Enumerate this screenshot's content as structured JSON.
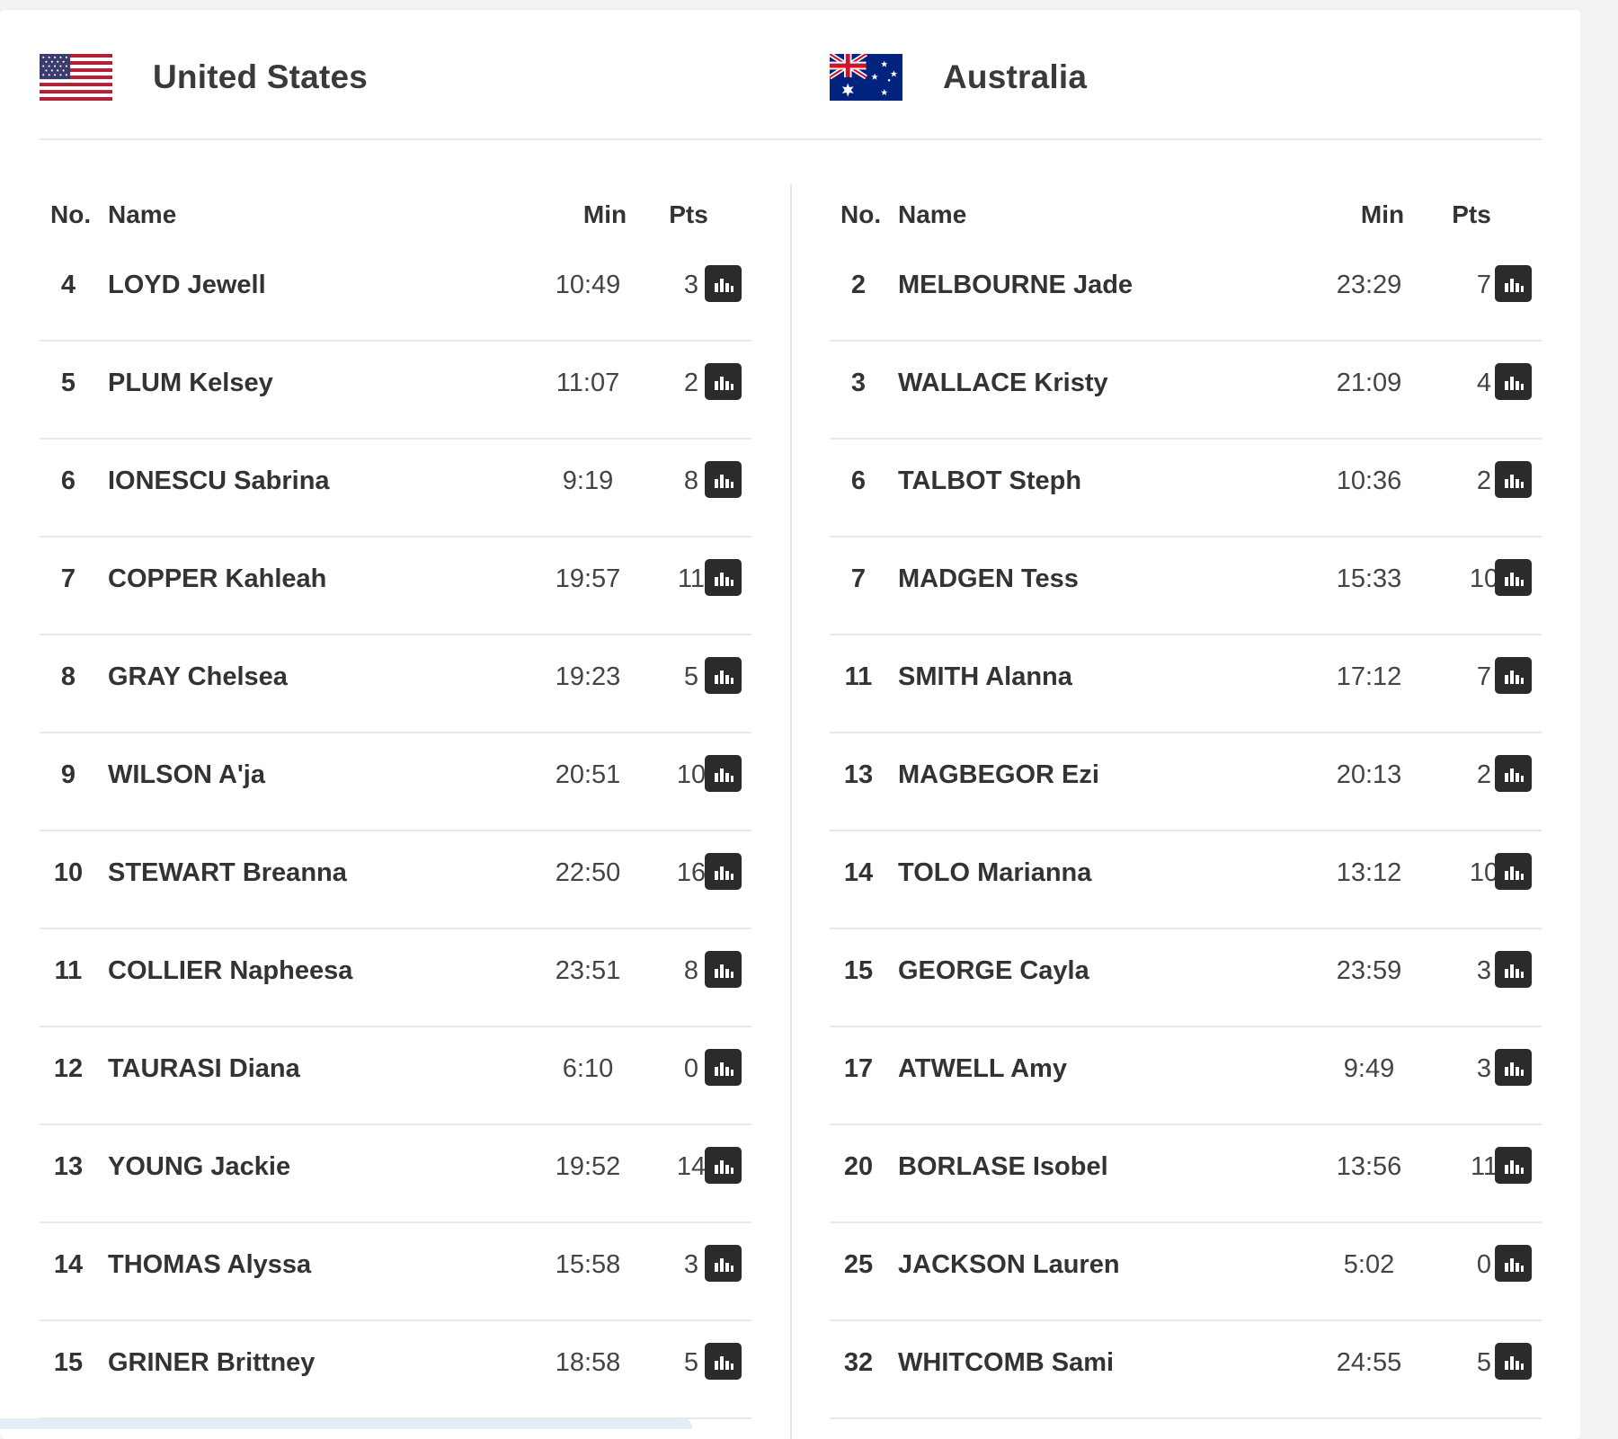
{
  "teams": [
    {
      "name": "United States",
      "flag": "us-flag",
      "columns": {
        "no": "No.",
        "name": "Name",
        "min": "Min",
        "pts": "Pts"
      },
      "players": [
        {
          "no": "4",
          "name": "LOYD Jewell",
          "min": "10:49",
          "pts": "3"
        },
        {
          "no": "5",
          "name": "PLUM Kelsey",
          "min": "11:07",
          "pts": "2"
        },
        {
          "no": "6",
          "name": "IONESCU Sabrina",
          "min": "9:19",
          "pts": "8"
        },
        {
          "no": "7",
          "name": "COPPER Kahleah",
          "min": "19:57",
          "pts": "11"
        },
        {
          "no": "8",
          "name": "GRAY Chelsea",
          "min": "19:23",
          "pts": "5"
        },
        {
          "no": "9",
          "name": "WILSON A'ja",
          "min": "20:51",
          "pts": "10"
        },
        {
          "no": "10",
          "name": "STEWART Breanna",
          "min": "22:50",
          "pts": "16"
        },
        {
          "no": "11",
          "name": "COLLIER Napheesa",
          "min": "23:51",
          "pts": "8"
        },
        {
          "no": "12",
          "name": "TAURASI Diana",
          "min": "6:10",
          "pts": "0"
        },
        {
          "no": "13",
          "name": "YOUNG Jackie",
          "min": "19:52",
          "pts": "14"
        },
        {
          "no": "14",
          "name": "THOMAS Alyssa",
          "min": "15:58",
          "pts": "3"
        },
        {
          "no": "15",
          "name": "GRINER Brittney",
          "min": "18:58",
          "pts": "5"
        }
      ]
    },
    {
      "name": "Australia",
      "flag": "australia-flag",
      "columns": {
        "no": "No.",
        "name": "Name",
        "min": "Min",
        "pts": "Pts"
      },
      "players": [
        {
          "no": "2",
          "name": "MELBOURNE Jade",
          "min": "23:29",
          "pts": "7"
        },
        {
          "no": "3",
          "name": "WALLACE Kristy",
          "min": "21:09",
          "pts": "4"
        },
        {
          "no": "6",
          "name": "TALBOT Steph",
          "min": "10:36",
          "pts": "2"
        },
        {
          "no": "7",
          "name": "MADGEN Tess",
          "min": "15:33",
          "pts": "10"
        },
        {
          "no": "11",
          "name": "SMITH Alanna",
          "min": "17:12",
          "pts": "7"
        },
        {
          "no": "13",
          "name": "MAGBEGOR Ezi",
          "min": "20:13",
          "pts": "2"
        },
        {
          "no": "14",
          "name": "TOLO Marianna",
          "min": "13:12",
          "pts": "10"
        },
        {
          "no": "15",
          "name": "GEORGE Cayla",
          "min": "23:59",
          "pts": "3"
        },
        {
          "no": "17",
          "name": "ATWELL Amy",
          "min": "9:49",
          "pts": "3"
        },
        {
          "no": "20",
          "name": "BORLASE Isobel",
          "min": "13:56",
          "pts": "11"
        },
        {
          "no": "25",
          "name": "JACKSON Lauren",
          "min": "5:02",
          "pts": "0"
        },
        {
          "no": "32",
          "name": "WHITCOMB Sami",
          "min": "24:55",
          "pts": "5"
        }
      ]
    }
  ],
  "icons": {
    "stats": "bar-chart-icon"
  },
  "colors": {
    "stats_button": "#2b2b2b",
    "divider": "#e8e8e8"
  }
}
